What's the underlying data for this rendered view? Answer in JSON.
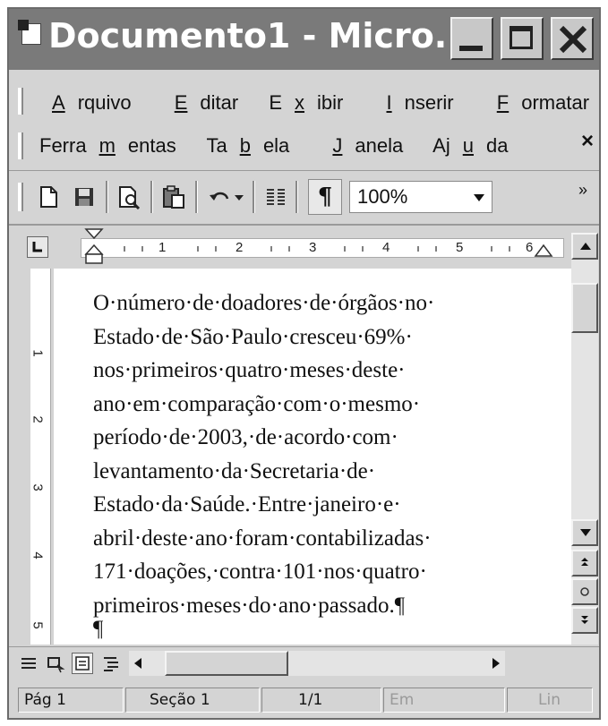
{
  "window": {
    "title": "Documento1 - Micro..."
  },
  "menu": {
    "row1": [
      {
        "pre": "",
        "u": "A",
        "post": "rquivo"
      },
      {
        "pre": "",
        "u": "E",
        "post": "ditar"
      },
      {
        "pre": "E",
        "u": "x",
        "post": "ibir"
      },
      {
        "pre": "",
        "u": "I",
        "post": "nserir"
      },
      {
        "pre": "",
        "u": "F",
        "post": "ormatar"
      }
    ],
    "row2": [
      {
        "pre": "Ferra",
        "u": "m",
        "post": "entas"
      },
      {
        "pre": "Ta",
        "u": "b",
        "post": "ela"
      },
      {
        "pre": "",
        "u": "J",
        "post": "anela"
      },
      {
        "pre": "Aj",
        "u": "u",
        "post": "da"
      }
    ],
    "close_glyph": "×"
  },
  "toolbar": {
    "pilcrow": "¶",
    "zoom": "100%",
    "more": "»"
  },
  "ruler": {
    "labels": [
      "1",
      "2",
      "3",
      "4",
      "5",
      "6"
    ]
  },
  "vruler": {
    "labels": [
      "1",
      "2",
      "3",
      "4",
      "5"
    ]
  },
  "document": {
    "lines": [
      "O·número·de·doadores·de·órgãos·no·",
      "Estado·de·São·Paulo·cresceu·69%·",
      "nos·primeiros·quatro·meses·deste·",
      "ano·em·comparação·com·o·mesmo·",
      "período·de·2003,·de·acordo·com·",
      "levantamento·da·Secretaria·de·",
      "Estado·da·Saúde.·Entre·janeiro·e·",
      "abril·deste·ano·foram·contabilizadas·",
      "171·doações,·contra·101·nos·quatro·",
      "primeiros·meses·do·ano·passado.¶",
      "¶"
    ]
  },
  "status": {
    "page": "Pág 1",
    "section": "Seção 1",
    "pages": "1/1",
    "em": "Em",
    "lin": "Lin"
  }
}
